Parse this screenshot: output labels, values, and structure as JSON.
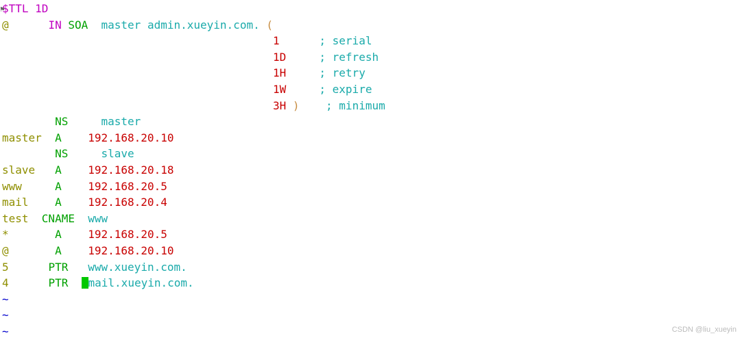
{
  "zone": {
    "ttl_directive": "$TTL",
    "ttl_value": "1D",
    "origin": "@",
    "in": "IN",
    "soa": "SOA",
    "mname": "master",
    "rname": "admin.xueyin.com.",
    "lparen": "(",
    "rparen": ")",
    "soa_values": {
      "serial": {
        "val": "1",
        "comment": "; serial"
      },
      "refresh": {
        "val": "1D",
        "comment": "; refresh"
      },
      "retry": {
        "val": "1H",
        "comment": "; retry"
      },
      "expire": {
        "val": "1W",
        "comment": "; expire"
      },
      "minimum": {
        "val": "3H",
        "comment": "; minimum"
      }
    },
    "records": {
      "ns1": {
        "name": "",
        "type": "NS",
        "data": "master"
      },
      "masterA": {
        "name": "master",
        "type": "A",
        "data": "192.168.20.10"
      },
      "ns2": {
        "name": "",
        "type": "NS",
        "data": "slave"
      },
      "slaveA": {
        "name": "slave",
        "type": "A",
        "data": "192.168.20.18"
      },
      "wwwA": {
        "name": "www",
        "type": "A",
        "data": "192.168.20.5"
      },
      "mailA": {
        "name": "mail",
        "type": "A",
        "data": "192.168.20.4"
      },
      "testC": {
        "name": "test",
        "type": "CNAME",
        "data": "www"
      },
      "starA": {
        "name": "*",
        "type": "A",
        "data": "192.168.20.5"
      },
      "atA": {
        "name": "@",
        "type": "A",
        "data": "192.168.20.10"
      },
      "ptr5": {
        "name": "5",
        "type": "PTR",
        "data": "www.xueyin.com."
      },
      "ptr4": {
        "name": "4",
        "type": "PTR",
        "data": "mail.xueyin.com."
      }
    }
  },
  "watermark": "CSDN @liu_xueyin"
}
